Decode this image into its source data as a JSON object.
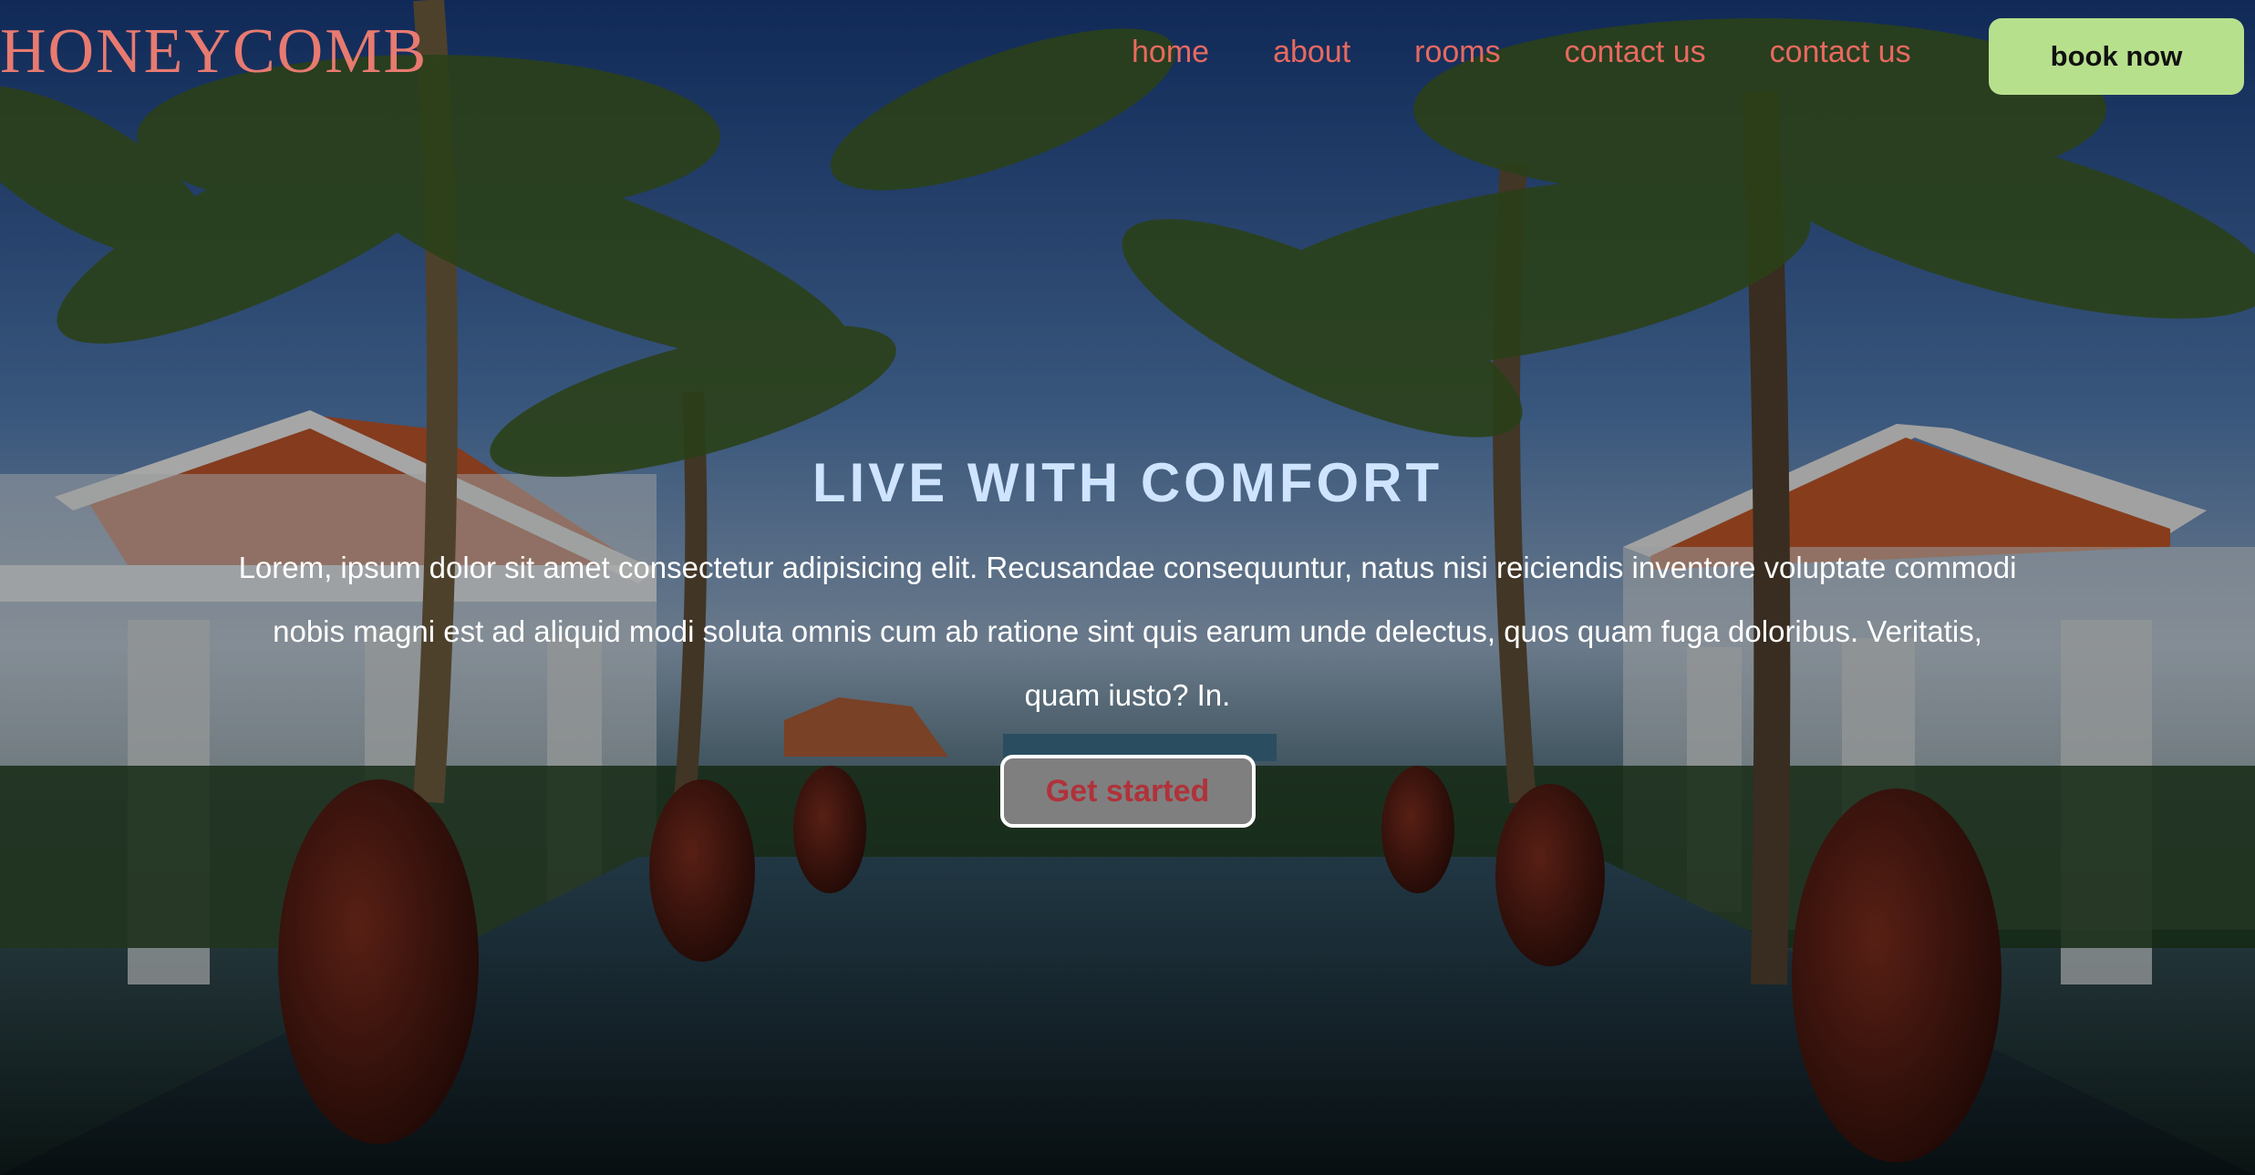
{
  "brand": {
    "name": "HONEYCOMB"
  },
  "nav": {
    "items": [
      {
        "label": "home"
      },
      {
        "label": "about"
      },
      {
        "label": "rooms"
      },
      {
        "label": "contact us"
      },
      {
        "label": "contact us"
      }
    ],
    "book_label": "book now"
  },
  "hero": {
    "headline": "LIVE WITH COMFORT",
    "body": "Lorem, ipsum dolor sit amet consectetur adipisicing elit. Recusandae consequuntur, natus nisi reiciendis inventore voluptate commodi nobis magni est ad aliquid modi soluta omnis cum ab ratione sint quis earum unde delectus, quos quam fuga doloribus. Veritatis, quam iusto? In.",
    "cta_label": "Get started",
    "background_image": "resort-pool-palm-trees"
  },
  "colors": {
    "brand": "#e87a70",
    "nav_link": "#e8695f",
    "book_button": "#b7e08d",
    "headline": "#cfe4ff",
    "cta_bg": "#7f7f7f",
    "cta_text": "#b0323a"
  }
}
